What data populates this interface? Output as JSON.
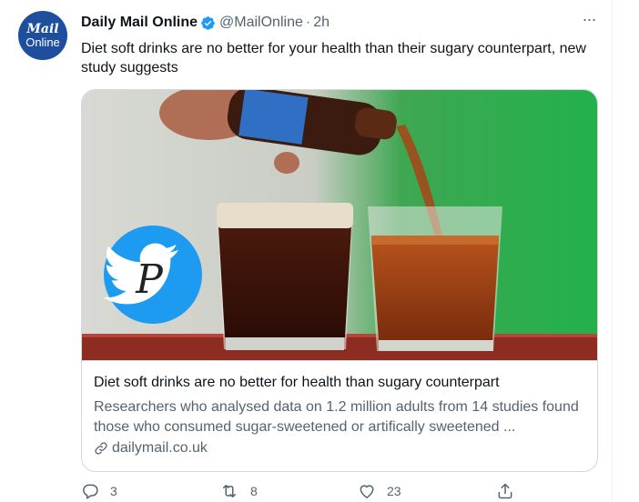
{
  "author": {
    "avatar_line1": "Mail",
    "avatar_line2": "Online",
    "name": "Daily Mail Online",
    "handle": "@MailOnline",
    "separator": "·",
    "time": "2h"
  },
  "tweet": {
    "text": "Diet soft drinks are no better for your health than their sugary counterpart, new study suggests"
  },
  "card": {
    "title": "Diet soft drinks are no better for health than sugary counterpart",
    "description": "Researchers who analysed data on 1.2 million adults from 14 studies found those who consumed sugar-sweetened or artifically sweetened ...",
    "domain": "dailymail.co.uk",
    "watermark_letter": "P"
  },
  "actions": {
    "reply_count": "3",
    "retweet_count": "8",
    "like_count": "23"
  },
  "colors": {
    "accent": "#1d9bf0",
    "text": "#0f1419",
    "secondary": "#536471",
    "border": "#cfd9de",
    "avatar_bg": "#1d4f9e"
  },
  "icons": [
    "verified-badge-icon",
    "more-icon",
    "link-icon",
    "reply-icon",
    "retweet-icon",
    "like-icon",
    "share-icon",
    "twitter-bird-icon"
  ]
}
